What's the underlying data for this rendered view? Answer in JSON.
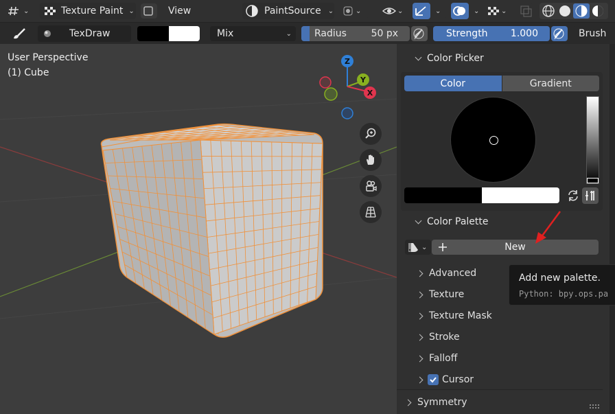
{
  "header": {
    "mode_label": "Texture Paint",
    "view_menu": "View",
    "paint_source": "PaintSource"
  },
  "toolbar": {
    "brush_name": "TexDraw",
    "blend_mode": "Mix",
    "radius_label": "Radius",
    "radius_value": "50 px",
    "strength_label": "Strength",
    "strength_value": "1.000",
    "brush_menu": "Brush",
    "primary_color": "#000000",
    "secondary_color": "#ffffff"
  },
  "viewport": {
    "perspective": "User Perspective",
    "object": "(1) Cube",
    "gizmo": {
      "z": "Z",
      "y": "Y",
      "x": "X"
    }
  },
  "panel": {
    "color_picker": {
      "title": "Color Picker",
      "tab_color": "Color",
      "tab_gradient": "Gradient"
    },
    "color_palette": {
      "title": "Color Palette",
      "new_button": "New"
    },
    "tooltip": {
      "title": "Add new palette.",
      "python": "Python: bpy.ops.pa"
    },
    "subpanels": [
      "Advanced",
      "Texture",
      "Texture Mask",
      "Stroke",
      "Falloff",
      "Cursor"
    ],
    "cursor_checked": true,
    "symmetry": "Symmetry"
  },
  "colors": {
    "accent": "#4772b3",
    "mesh_wire": "#f0913a",
    "gizmo_x": "#e0354e",
    "gizmo_y": "#88b020",
    "gizmo_z": "#2f80d8"
  },
  "icons": [
    "grid-icon",
    "checker-icon",
    "window-icon",
    "paint-source-icon",
    "circle-dot-icon",
    "eye-icon",
    "gizmo-icon",
    "overlay-icon",
    "checker-overlay-icon",
    "xray-icon",
    "wireframe-icon",
    "solid-icon",
    "material-icon",
    "rendered-icon",
    "brush-icon",
    "zoom-icon",
    "hand-icon",
    "camera-icon",
    "perspective-grid-icon",
    "swap-icon",
    "eyedropper-icon",
    "palette-icon",
    "plus-icon",
    "red-arrow-icon"
  ]
}
